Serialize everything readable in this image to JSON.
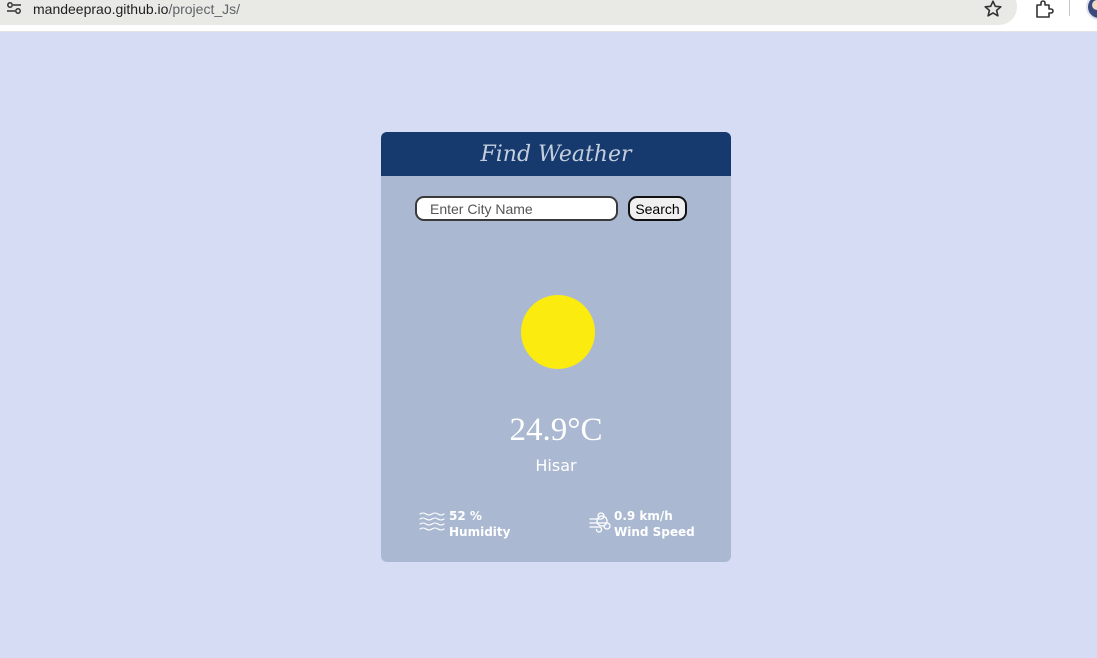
{
  "browser": {
    "url_host": "mandeeprao.github.io",
    "url_path": "/project_Js/"
  },
  "card": {
    "title": "Find Weather",
    "search": {
      "placeholder": "Enter City Name",
      "value": "",
      "button_label": "Search"
    },
    "weather": {
      "icon": "sun-icon",
      "temperature": "24.9°C",
      "city": "Hisar"
    },
    "humidity": {
      "icon": "humidity-waves-icon",
      "value": "52 %",
      "label": "Humidity"
    },
    "wind": {
      "icon": "wind-icon",
      "value": "0.9 km/h",
      "label": "Wind Speed"
    }
  },
  "colors": {
    "page_background": "#d5dcf4",
    "card_background": "#aab9d1",
    "header_background": "#163a6d",
    "sun": "#fbeb0e"
  }
}
